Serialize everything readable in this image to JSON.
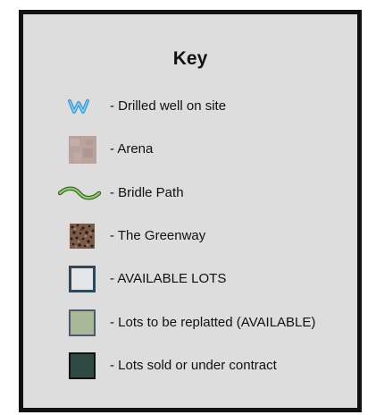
{
  "legend": {
    "title": "Key",
    "items": [
      {
        "icon": "drilled-well-icon",
        "label": "- Drilled well on site",
        "color": "#2e9bd4"
      },
      {
        "icon": "arena-swatch",
        "label": "- Arena",
        "color": "#b9a39c"
      },
      {
        "icon": "bridle-path-icon",
        "label": "- Bridle Path",
        "color": "#6fbf4a"
      },
      {
        "icon": "greenway-swatch",
        "label": "- The Greenway",
        "color": "#6b4a3a"
      },
      {
        "icon": "available-lots-swatch",
        "label": "- AVAILABLE LOTS",
        "color": "#e4e6ea",
        "border": "#2e4a5a"
      },
      {
        "icon": "replatted-lots-swatch",
        "label": "- Lots to be replatted (AVAILABLE)",
        "color": "#a8b898",
        "border": "#4a5a6a"
      },
      {
        "icon": "sold-lots-swatch",
        "label": "- Lots sold or under contract",
        "color": "#2e4a42",
        "border": "#111111"
      }
    ]
  }
}
